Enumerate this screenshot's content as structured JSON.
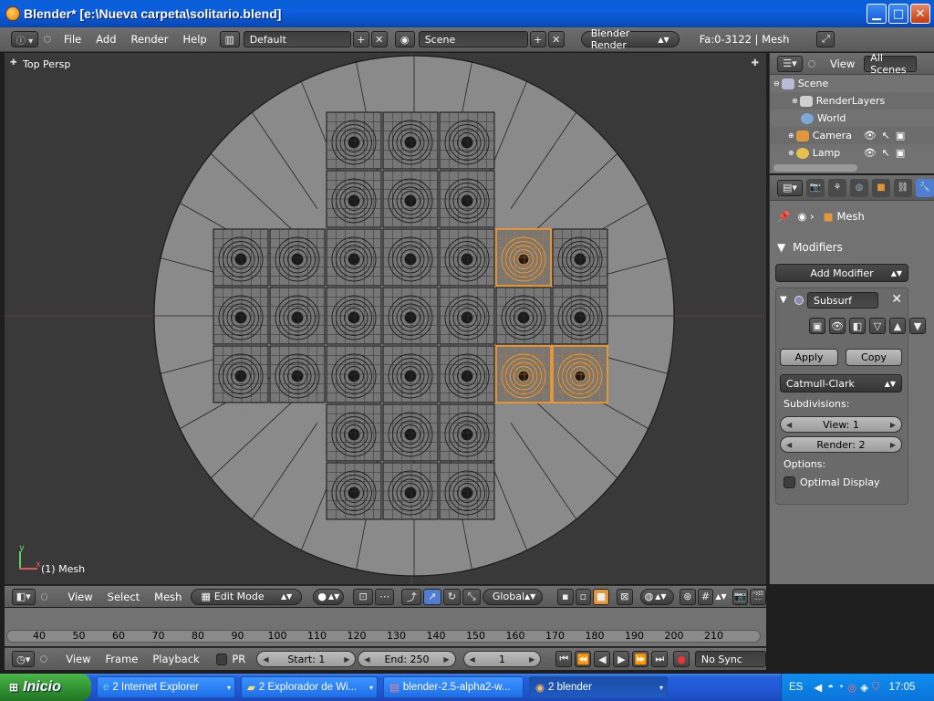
{
  "window": {
    "title": "Blender* [e:\\Nueva carpeta\\solitario.blend]"
  },
  "info_header": {
    "menus": [
      "File",
      "Add",
      "Render",
      "Help"
    ],
    "screen_layout": "Default",
    "scene": "Scene",
    "render_engine": "Blender Render",
    "stats": "Fa:0-3122 | Mesh"
  },
  "viewport": {
    "view_label": "Top Persp",
    "object_label": "(1) Mesh",
    "axis_y": "y",
    "axis_x": "x"
  },
  "outliner": {
    "view_menu": "View",
    "filter": "All Scenes",
    "items": [
      {
        "label": "Scene",
        "icon": "scene-icon"
      },
      {
        "label": "RenderLayers",
        "icon": "renderlayers-icon"
      },
      {
        "label": "World",
        "icon": "world-icon"
      },
      {
        "label": "Camera",
        "icon": "camera-icon"
      },
      {
        "label": "Lamp",
        "icon": "lamp-icon"
      }
    ]
  },
  "properties": {
    "context": "Mesh",
    "panel_title": "Modifiers",
    "add_modifier": "Add Modifier",
    "modifier_name": "Subsurf",
    "apply": "Apply",
    "copy": "Copy",
    "subdiv_type": "Catmull-Clark",
    "subdivisions_label": "Subdivisions:",
    "view_levels": "View: 1",
    "render_levels": "Render: 2",
    "options_label": "Options:",
    "optimal_display": "Optimal Display"
  },
  "viewport_header": {
    "menus": [
      "View",
      "Select",
      "Mesh"
    ],
    "mode": "Edit Mode",
    "orientation": "Global"
  },
  "timeline": {
    "ticks": [
      "40",
      "50",
      "60",
      "70",
      "80",
      "90",
      "100",
      "110",
      "120",
      "130",
      "140",
      "150",
      "160",
      "170",
      "180",
      "190",
      "200",
      "210"
    ]
  },
  "timeline_header": {
    "menus": [
      "View",
      "Frame",
      "Playback"
    ],
    "pr": "PR",
    "start": "Start: 1",
    "end": "End: 250",
    "current": "1",
    "sync": "No Sync"
  },
  "taskbar": {
    "start": "Inicio",
    "tasks": [
      "2 Internet Explorer",
      "2 Explorador de Wi...",
      "blender-2.5-alpha2-w...",
      "2 blender"
    ],
    "lang": "ES",
    "clock": "17:05"
  },
  "colors": {
    "accent": "#4f7ed2",
    "selection": "#ff9b1d"
  }
}
